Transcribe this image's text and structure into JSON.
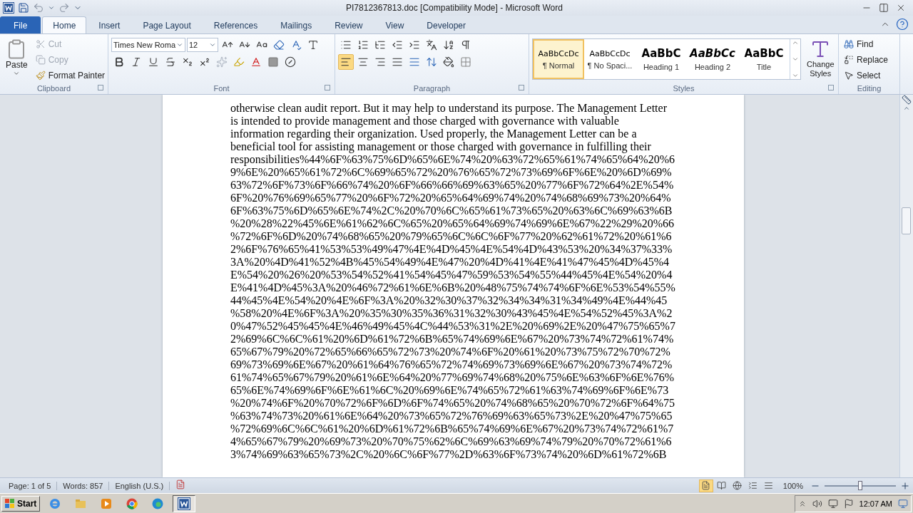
{
  "window": {
    "title": "PI7812367813.doc [Compatibility Mode]  -  Microsoft Word"
  },
  "tabs": [
    {
      "label": "File",
      "kind": "file",
      "selected": false
    },
    {
      "label": "Home",
      "kind": "tab",
      "selected": true
    },
    {
      "label": "Insert",
      "kind": "tab",
      "selected": false
    },
    {
      "label": "Page Layout",
      "kind": "tab",
      "selected": false
    },
    {
      "label": "References",
      "kind": "tab",
      "selected": false
    },
    {
      "label": "Mailings",
      "kind": "tab",
      "selected": false
    },
    {
      "label": "Review",
      "kind": "tab",
      "selected": false
    },
    {
      "label": "View",
      "kind": "tab",
      "selected": false
    },
    {
      "label": "Developer",
      "kind": "tab",
      "selected": false
    }
  ],
  "ribbon": {
    "clipboard": {
      "label": "Clipboard",
      "paste": "Paste",
      "cut": {
        "label": "Cut",
        "disabled": true
      },
      "copy": {
        "label": "Copy",
        "disabled": true
      },
      "format_painter": "Format Painter"
    },
    "font": {
      "label": "Font",
      "name": "Times New Roma",
      "size": "12"
    },
    "paragraph": {
      "label": "Paragraph",
      "alignment": [
        {
          "kind": "left",
          "selected": true
        },
        {
          "kind": "center",
          "selected": false
        },
        {
          "kind": "right",
          "selected": false
        },
        {
          "kind": "justify",
          "selected": false
        }
      ]
    },
    "styles": {
      "label": "Styles",
      "items": [
        {
          "preview": "AaBbCcDc",
          "name": "¶ Normal",
          "kind": "normal",
          "selected": true
        },
        {
          "preview": "AaBbCcDc",
          "name": "¶ No Spaci...",
          "kind": "normal",
          "selected": false
        },
        {
          "preview": "AaBbC",
          "name": "Heading 1",
          "kind": "heading",
          "selected": false
        },
        {
          "preview": "AaBbCc",
          "name": "Heading 2",
          "kind": "heading_italic",
          "selected": false
        },
        {
          "preview": "AaBbC",
          "name": "Title",
          "kind": "title",
          "selected": false
        }
      ],
      "change_styles": "Change Styles"
    },
    "editing": {
      "label": "Editing",
      "find": "Find",
      "replace": "Replace",
      "select": "Select"
    }
  },
  "document": {
    "lines": [
      "otherwise clean audit report. But it may help to understand its purpose. The Management Letter",
      "is intended to provide management and those charged with governance with valuable",
      "information regarding their organization. Used properly, the Management Letter can be a",
      "beneficial tool for assisting management or those charged with governance in fulfilling their",
      "responsibilities%44%6F%63%75%6D%65%6E%74%20%63%72%65%61%74%65%64%20%6",
      "9%6E%20%65%61%72%6C%69%65%72%20%76%65%72%73%69%6F%6E%20%6D%69%",
      "63%72%6F%73%6F%66%74%20%6F%66%66%69%63%65%20%77%6F%72%64%2E%54%",
      "6F%20%76%69%65%77%20%6F%72%20%65%64%69%74%20%74%68%69%73%20%64%",
      "6F%63%75%6D%65%6E%74%2C%20%70%6C%65%61%73%65%20%63%6C%69%63%6B",
      "%20%28%22%45%6E%61%62%6C%65%20%65%64%69%74%69%6E%67%22%29%20%66",
      "%72%6F%6D%20%74%68%65%20%79%65%6C%6C%6F%77%20%62%61%72%20%61%6",
      "2%6F%76%65%41%53%53%49%47%4E%4D%45%4E%54%4D%43%53%20%34%37%33%",
      "3A%20%4D%41%52%4B%45%54%49%4E%47%20%4D%41%4E%41%47%45%4D%45%4",
      "E%54%20%26%20%53%54%52%41%54%45%47%59%53%54%55%44%45%4E%54%20%4",
      "E%41%4D%45%3A%20%46%72%61%6E%6B%20%48%75%74%74%6F%6E%53%54%55%",
      "44%45%4E%54%20%4E%6F%3A%20%32%30%37%32%34%34%31%34%49%4E%44%45",
      "%58%20%4E%6F%3A%20%35%30%35%36%31%32%30%43%45%4E%54%52%45%3A%2",
      "0%47%52%45%45%4E%46%49%45%4C%44%53%31%2E%20%69%2E%20%47%75%65%7",
      "2%69%6C%6C%61%20%6D%61%72%6B%65%74%69%6E%67%20%73%74%72%61%74%",
      "65%67%79%20%72%65%66%65%72%73%20%74%6F%20%61%20%73%75%72%70%72%",
      "69%73%69%6E%67%20%61%64%76%65%72%74%69%73%69%6E%67%20%73%74%72%",
      "61%74%65%67%79%20%61%6E%64%20%77%69%74%68%20%75%6E%63%6F%6E%76%",
      "65%6E%74%69%6F%6E%61%6C%20%69%6E%74%65%72%61%63%74%69%6F%6E%73",
      "%20%74%6F%20%70%72%6F%6D%6F%74%65%20%74%68%65%20%70%72%6F%64%75",
      "%63%74%73%20%61%6E%64%20%73%65%72%76%69%63%65%73%2E%20%47%75%65",
      "%72%69%6C%6C%61%20%6D%61%72%6B%65%74%69%6E%67%20%73%74%72%61%7",
      "4%65%67%79%20%69%73%20%70%75%62%6C%69%63%69%74%79%20%70%72%61%6",
      "3%74%69%63%65%73%2C%20%6C%6F%77%2D%63%6F%73%74%20%6D%61%72%6B"
    ]
  },
  "status_bar": {
    "page": "Page: 1 of 5",
    "words": "Words: 857",
    "language": "English (U.S.)",
    "views": [
      {
        "kind": "print",
        "selected": true
      },
      {
        "kind": "reading",
        "selected": false
      },
      {
        "kind": "web",
        "selected": false
      },
      {
        "kind": "outline",
        "selected": false
      },
      {
        "kind": "draft",
        "selected": false
      }
    ],
    "zoom": "100%",
    "zoom_slider": {
      "level": 0.5
    }
  },
  "taskbar": {
    "start": "Start",
    "time": "12:07 AM"
  }
}
